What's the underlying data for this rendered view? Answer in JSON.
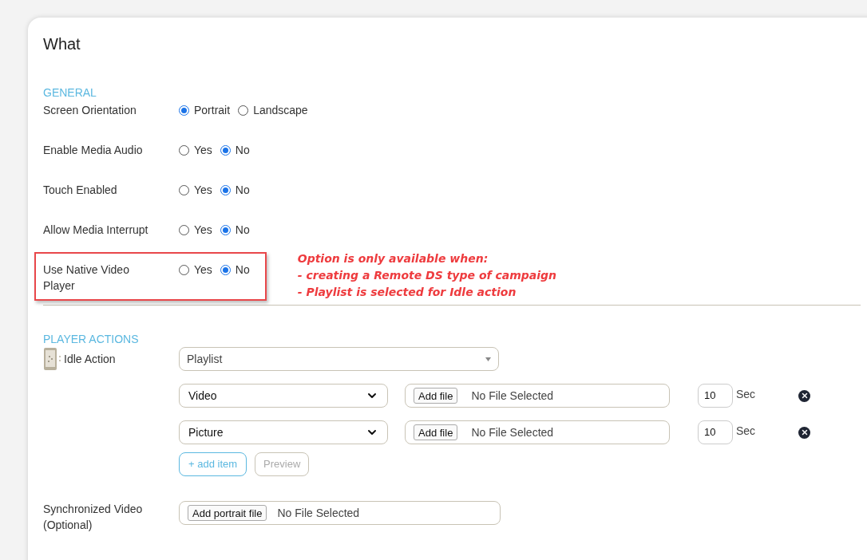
{
  "title": "What",
  "general": {
    "heading": "GENERAL",
    "settings": [
      {
        "label": "Screen Orientation",
        "highlighted": false,
        "options": [
          {
            "label": "Portrait",
            "selected": true
          },
          {
            "label": "Landscape",
            "selected": false
          }
        ]
      },
      {
        "label": "Enable Media Audio",
        "highlighted": false,
        "options": [
          {
            "label": "Yes",
            "selected": false
          },
          {
            "label": "No",
            "selected": true
          }
        ]
      },
      {
        "label": "Touch Enabled",
        "highlighted": false,
        "options": [
          {
            "label": "Yes",
            "selected": false
          },
          {
            "label": "No",
            "selected": true
          }
        ]
      },
      {
        "label": "Allow Media Interrupt",
        "highlighted": false,
        "options": [
          {
            "label": "Yes",
            "selected": false
          },
          {
            "label": "No",
            "selected": true
          }
        ]
      },
      {
        "label": "Use Native Video Player",
        "highlighted": true,
        "options": [
          {
            "label": "Yes",
            "selected": false
          },
          {
            "label": "No",
            "selected": true
          }
        ]
      }
    ],
    "annotation": [
      "Option is only available when:",
      "- creating a Remote DS type of campaign",
      "- Playlist is selected for Idle action"
    ]
  },
  "player_actions": {
    "heading": "PLAYER ACTIONS",
    "idle_action": {
      "label": "Idle Action",
      "value": "Playlist"
    },
    "items": [
      {
        "type": "Video",
        "button": "Add file",
        "file_status": "No File Selected",
        "seconds": "10",
        "unit": "Sec"
      },
      {
        "type": "Picture",
        "button": "Add file",
        "file_status": "No File Selected",
        "seconds": "10",
        "unit": "Sec"
      }
    ],
    "add_button": {
      "label": "+ add item",
      "disabled": false
    },
    "preview_button": {
      "label": "Preview",
      "disabled": true
    }
  },
  "synchronized_video": {
    "label": "Synchronized Video (Optional)",
    "button": "Add portrait file",
    "file_status": "No File Selected"
  }
}
